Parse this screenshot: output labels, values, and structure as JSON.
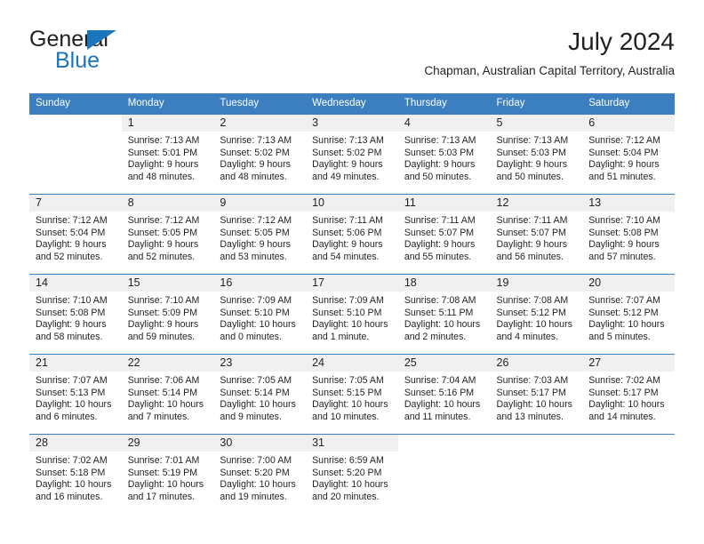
{
  "brand": {
    "name_top": "General",
    "name_bottom": "Blue",
    "accent_color": "#1b75bb"
  },
  "header": {
    "title": "July 2024",
    "subtitle": "Chapman, Australian Capital Territory, Australia"
  },
  "calendar": {
    "header_bg": "#3c7fc1",
    "daynum_bg": "#f0f0f0",
    "weekday_names": [
      "Sunday",
      "Monday",
      "Tuesday",
      "Wednesday",
      "Thursday",
      "Friday",
      "Saturday"
    ],
    "weeks": [
      [
        {
          "day": "",
          "lines": []
        },
        {
          "day": "1",
          "lines": [
            "Sunrise: 7:13 AM",
            "Sunset: 5:01 PM",
            "Daylight: 9 hours",
            "and 48 minutes."
          ]
        },
        {
          "day": "2",
          "lines": [
            "Sunrise: 7:13 AM",
            "Sunset: 5:02 PM",
            "Daylight: 9 hours",
            "and 48 minutes."
          ]
        },
        {
          "day": "3",
          "lines": [
            "Sunrise: 7:13 AM",
            "Sunset: 5:02 PM",
            "Daylight: 9 hours",
            "and 49 minutes."
          ]
        },
        {
          "day": "4",
          "lines": [
            "Sunrise: 7:13 AM",
            "Sunset: 5:03 PM",
            "Daylight: 9 hours",
            "and 50 minutes."
          ]
        },
        {
          "day": "5",
          "lines": [
            "Sunrise: 7:13 AM",
            "Sunset: 5:03 PM",
            "Daylight: 9 hours",
            "and 50 minutes."
          ]
        },
        {
          "day": "6",
          "lines": [
            "Sunrise: 7:12 AM",
            "Sunset: 5:04 PM",
            "Daylight: 9 hours",
            "and 51 minutes."
          ]
        }
      ],
      [
        {
          "day": "7",
          "lines": [
            "Sunrise: 7:12 AM",
            "Sunset: 5:04 PM",
            "Daylight: 9 hours",
            "and 52 minutes."
          ]
        },
        {
          "day": "8",
          "lines": [
            "Sunrise: 7:12 AM",
            "Sunset: 5:05 PM",
            "Daylight: 9 hours",
            "and 52 minutes."
          ]
        },
        {
          "day": "9",
          "lines": [
            "Sunrise: 7:12 AM",
            "Sunset: 5:05 PM",
            "Daylight: 9 hours",
            "and 53 minutes."
          ]
        },
        {
          "day": "10",
          "lines": [
            "Sunrise: 7:11 AM",
            "Sunset: 5:06 PM",
            "Daylight: 9 hours",
            "and 54 minutes."
          ]
        },
        {
          "day": "11",
          "lines": [
            "Sunrise: 7:11 AM",
            "Sunset: 5:07 PM",
            "Daylight: 9 hours",
            "and 55 minutes."
          ]
        },
        {
          "day": "12",
          "lines": [
            "Sunrise: 7:11 AM",
            "Sunset: 5:07 PM",
            "Daylight: 9 hours",
            "and 56 minutes."
          ]
        },
        {
          "day": "13",
          "lines": [
            "Sunrise: 7:10 AM",
            "Sunset: 5:08 PM",
            "Daylight: 9 hours",
            "and 57 minutes."
          ]
        }
      ],
      [
        {
          "day": "14",
          "lines": [
            "Sunrise: 7:10 AM",
            "Sunset: 5:08 PM",
            "Daylight: 9 hours",
            "and 58 minutes."
          ]
        },
        {
          "day": "15",
          "lines": [
            "Sunrise: 7:10 AM",
            "Sunset: 5:09 PM",
            "Daylight: 9 hours",
            "and 59 minutes."
          ]
        },
        {
          "day": "16",
          "lines": [
            "Sunrise: 7:09 AM",
            "Sunset: 5:10 PM",
            "Daylight: 10 hours",
            "and 0 minutes."
          ]
        },
        {
          "day": "17",
          "lines": [
            "Sunrise: 7:09 AM",
            "Sunset: 5:10 PM",
            "Daylight: 10 hours",
            "and 1 minute."
          ]
        },
        {
          "day": "18",
          "lines": [
            "Sunrise: 7:08 AM",
            "Sunset: 5:11 PM",
            "Daylight: 10 hours",
            "and 2 minutes."
          ]
        },
        {
          "day": "19",
          "lines": [
            "Sunrise: 7:08 AM",
            "Sunset: 5:12 PM",
            "Daylight: 10 hours",
            "and 4 minutes."
          ]
        },
        {
          "day": "20",
          "lines": [
            "Sunrise: 7:07 AM",
            "Sunset: 5:12 PM",
            "Daylight: 10 hours",
            "and 5 minutes."
          ]
        }
      ],
      [
        {
          "day": "21",
          "lines": [
            "Sunrise: 7:07 AM",
            "Sunset: 5:13 PM",
            "Daylight: 10 hours",
            "and 6 minutes."
          ]
        },
        {
          "day": "22",
          "lines": [
            "Sunrise: 7:06 AM",
            "Sunset: 5:14 PM",
            "Daylight: 10 hours",
            "and 7 minutes."
          ]
        },
        {
          "day": "23",
          "lines": [
            "Sunrise: 7:05 AM",
            "Sunset: 5:14 PM",
            "Daylight: 10 hours",
            "and 9 minutes."
          ]
        },
        {
          "day": "24",
          "lines": [
            "Sunrise: 7:05 AM",
            "Sunset: 5:15 PM",
            "Daylight: 10 hours",
            "and 10 minutes."
          ]
        },
        {
          "day": "25",
          "lines": [
            "Sunrise: 7:04 AM",
            "Sunset: 5:16 PM",
            "Daylight: 10 hours",
            "and 11 minutes."
          ]
        },
        {
          "day": "26",
          "lines": [
            "Sunrise: 7:03 AM",
            "Sunset: 5:17 PM",
            "Daylight: 10 hours",
            "and 13 minutes."
          ]
        },
        {
          "day": "27",
          "lines": [
            "Sunrise: 7:02 AM",
            "Sunset: 5:17 PM",
            "Daylight: 10 hours",
            "and 14 minutes."
          ]
        }
      ],
      [
        {
          "day": "28",
          "lines": [
            "Sunrise: 7:02 AM",
            "Sunset: 5:18 PM",
            "Daylight: 10 hours",
            "and 16 minutes."
          ]
        },
        {
          "day": "29",
          "lines": [
            "Sunrise: 7:01 AM",
            "Sunset: 5:19 PM",
            "Daylight: 10 hours",
            "and 17 minutes."
          ]
        },
        {
          "day": "30",
          "lines": [
            "Sunrise: 7:00 AM",
            "Sunset: 5:20 PM",
            "Daylight: 10 hours",
            "and 19 minutes."
          ]
        },
        {
          "day": "31",
          "lines": [
            "Sunrise: 6:59 AM",
            "Sunset: 5:20 PM",
            "Daylight: 10 hours",
            "and 20 minutes."
          ]
        },
        {
          "day": "",
          "lines": []
        },
        {
          "day": "",
          "lines": []
        },
        {
          "day": "",
          "lines": []
        }
      ]
    ]
  }
}
